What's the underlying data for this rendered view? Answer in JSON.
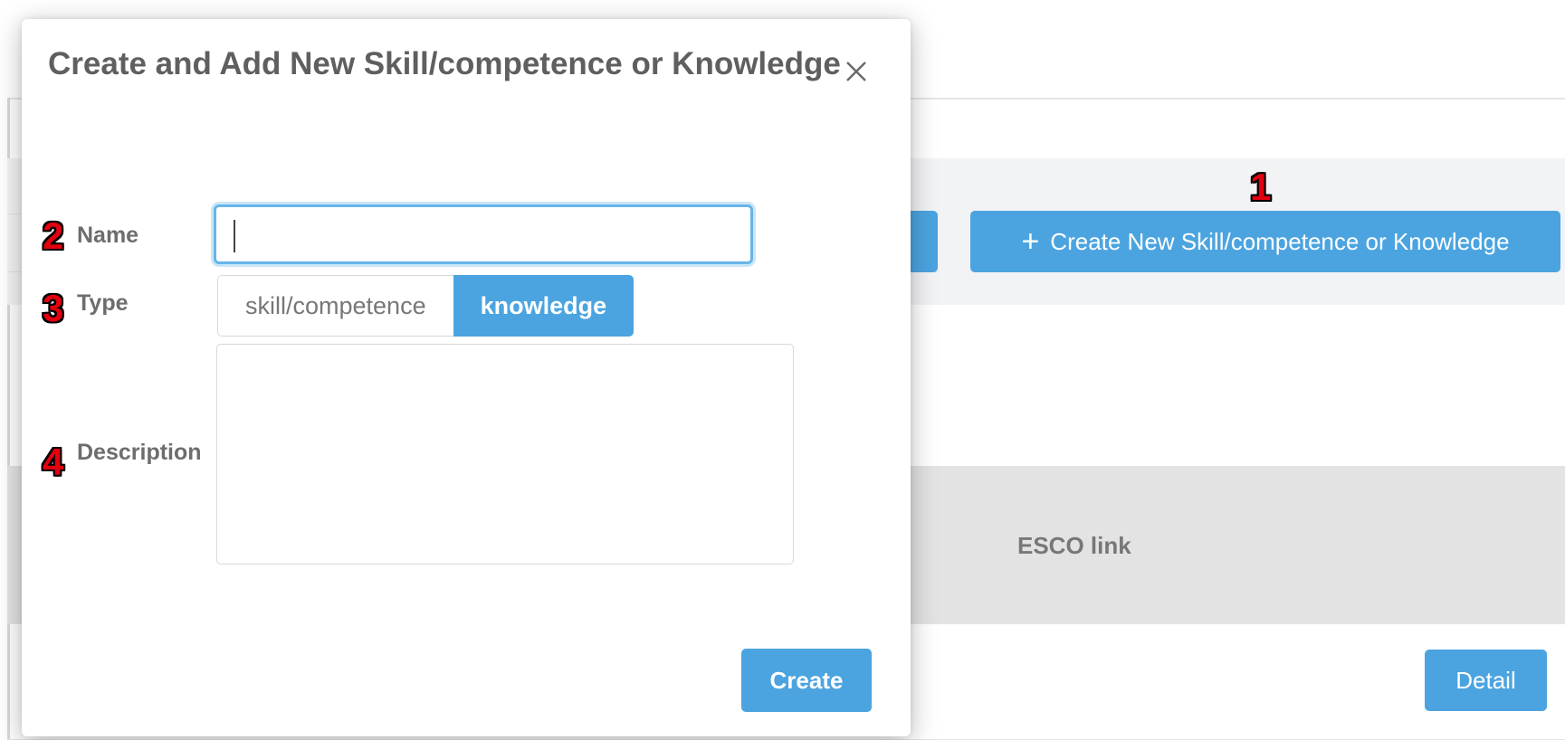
{
  "background": {
    "create_new_button": "Create New Skill/competence or Knowledge",
    "esco_link_header": "ESCO link",
    "detail_button": "Detail"
  },
  "modal": {
    "title": "Create and Add New Skill/competence or Knowledge",
    "name_label": "Name",
    "name_value": "",
    "type_label": "Type",
    "type_options": [
      "skill/competence",
      "knowledge"
    ],
    "type_selected": "knowledge",
    "description_label": "Description",
    "description_value": "",
    "create_button": "Create"
  },
  "markers": [
    "1",
    "2",
    "3",
    "4"
  ],
  "colors": {
    "accent": "#4ba4e0",
    "marker": "#e3000f",
    "label": "#6d6d6d"
  },
  "icons": {
    "close": "close-icon",
    "plus": "plus-icon"
  }
}
